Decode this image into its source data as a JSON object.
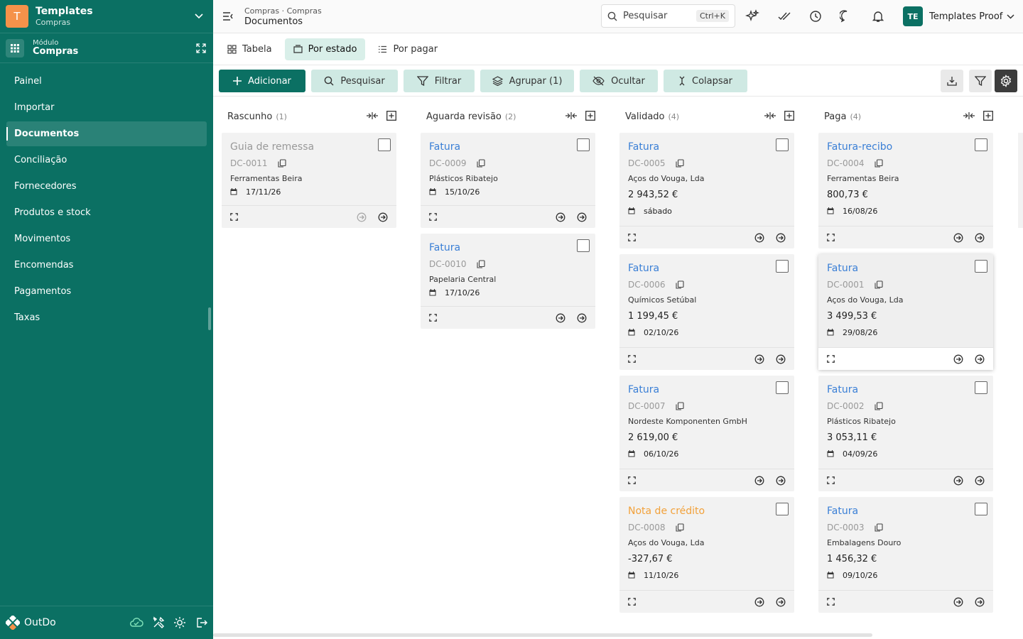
{
  "workspace": {
    "initial": "T",
    "title": "Templates",
    "subtitle": "Compras"
  },
  "module": {
    "label": "Módulo",
    "name": "Compras"
  },
  "nav": {
    "items": [
      "Painel",
      "Importar",
      "Documentos",
      "Conciliação",
      "Fornecedores",
      "Produtos e stock",
      "Movimentos",
      "Encomendas",
      "Pagamentos",
      "Taxas"
    ],
    "active": "Documentos"
  },
  "footer": {
    "brand": "OutDo"
  },
  "topbar": {
    "breadcrumb": "Compras · Compras",
    "page_title": "Documentos",
    "search_placeholder": "Pesquisar",
    "shortcut": "Ctrl+K",
    "user_initials": "TE",
    "user_name": "Templates Proof"
  },
  "views": {
    "table": "Tabela",
    "by_state": "Por estado",
    "to_pay": "Por pagar",
    "active": "Por estado"
  },
  "toolbar": {
    "add": "Adicionar",
    "search": "Pesquisar",
    "filter": "Filtrar",
    "group": "Agrupar (1)",
    "hide": "Ocultar",
    "collapse": "Colapsar"
  },
  "colors": {
    "brand": "#0b7063",
    "accent_light": "#cfe9e3",
    "link": "#3a7fd6",
    "warning": "#f2a13a",
    "logo": "#f5924a"
  },
  "columns": [
    {
      "name": "Rascunho",
      "count": "(1)",
      "cards": [
        {
          "title": "Guia de remessa",
          "code": "DC-0011",
          "supplier": "Ferramentas Beira",
          "amount": "",
          "date": "17/11/26",
          "style": "draft"
        }
      ]
    },
    {
      "name": "Aguarda revisão",
      "count": "(2)",
      "cards": [
        {
          "title": "Fatura",
          "code": "DC-0009",
          "supplier": "Plásticos Ribatejo",
          "amount": "",
          "date": "15/10/26",
          "style": "link"
        },
        {
          "title": "Fatura",
          "code": "DC-0010",
          "supplier": "Papelaria Central",
          "amount": "",
          "date": "17/10/26",
          "style": "link"
        }
      ]
    },
    {
      "name": "Validado",
      "count": "(4)",
      "cards": [
        {
          "title": "Fatura",
          "code": "DC-0005",
          "supplier": "Aços do Vouga, Lda",
          "amount": "2 943,52 €",
          "date": "sábado",
          "style": "link"
        },
        {
          "title": "Fatura",
          "code": "DC-0006",
          "supplier": "Químicos Setúbal",
          "amount": "1 199,45 €",
          "date": "02/10/26",
          "style": "link"
        },
        {
          "title": "Fatura",
          "code": "DC-0007",
          "supplier": "Nordeste Komponenten GmbH",
          "amount": "2 619,00 €",
          "date": "06/10/26",
          "style": "link"
        },
        {
          "title": "Nota de crédito",
          "code": "DC-0008",
          "supplier": "Aços do Vouga, Lda",
          "amount": "-327,67 €",
          "date": "11/10/26",
          "style": "orange"
        }
      ]
    },
    {
      "name": "Paga",
      "count": "(4)",
      "cards": [
        {
          "title": "Fatura-recibo",
          "code": "DC-0004",
          "supplier": "Ferramentas Beira",
          "amount": "800,73 €",
          "date": "16/08/26",
          "style": "link"
        },
        {
          "title": "Fatura",
          "code": "DC-0001",
          "supplier": "Aços do Vouga, Lda",
          "amount": "3 499,53 €",
          "date": "29/08/26",
          "style": "link",
          "selected": true
        },
        {
          "title": "Fatura",
          "code": "DC-0002",
          "supplier": "Plásticos Ribatejo",
          "amount": "3 053,11 €",
          "date": "04/09/26",
          "style": "link"
        },
        {
          "title": "Fatura",
          "code": "DC-0003",
          "supplier": "Embalagens Douro",
          "amount": "1 456,32 €",
          "date": "09/10/26",
          "style": "link"
        }
      ]
    }
  ]
}
